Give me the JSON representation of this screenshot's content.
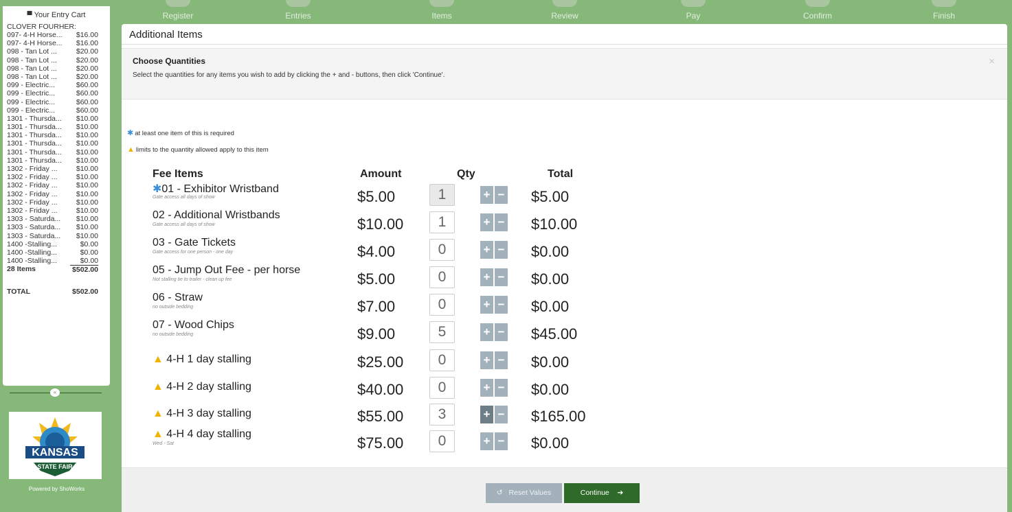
{
  "cart": {
    "title": "Your Entry Cart",
    "icon": "cart-icon",
    "owner": "CLOVER FOURHER:",
    "items": [
      {
        "name": "097- 4-H Horse...",
        "price": "$16.00"
      },
      {
        "name": "097- 4-H Horse...",
        "price": "$16.00"
      },
      {
        "name": "098 - Tan Lot ...",
        "price": "$20.00"
      },
      {
        "name": "098 - Tan Lot ...",
        "price": "$20.00"
      },
      {
        "name": "098 - Tan Lot ...",
        "price": "$20.00"
      },
      {
        "name": "098 - Tan Lot ...",
        "price": "$20.00"
      },
      {
        "name": "099 - Electric...",
        "price": "$60.00"
      },
      {
        "name": "099 - Electric...",
        "price": "$60.00"
      },
      {
        "name": "099 - Electric...",
        "price": "$60.00"
      },
      {
        "name": "099 - Electric...",
        "price": "$60.00"
      },
      {
        "name": "1301 - Thursda...",
        "price": "$10.00"
      },
      {
        "name": "1301 - Thursda...",
        "price": "$10.00"
      },
      {
        "name": "1301 - Thursda...",
        "price": "$10.00"
      },
      {
        "name": "1301 - Thursda...",
        "price": "$10.00"
      },
      {
        "name": "1301 - Thursda...",
        "price": "$10.00"
      },
      {
        "name": "1301 - Thursda...",
        "price": "$10.00"
      },
      {
        "name": "1302 - Friday ...",
        "price": "$10.00"
      },
      {
        "name": "1302 - Friday ...",
        "price": "$10.00"
      },
      {
        "name": "1302 - Friday ...",
        "price": "$10.00"
      },
      {
        "name": "1302 - Friday ...",
        "price": "$10.00"
      },
      {
        "name": "1302 - Friday ...",
        "price": "$10.00"
      },
      {
        "name": "1302 - Friday ...",
        "price": "$10.00"
      },
      {
        "name": "1303 - Saturda...",
        "price": "$10.00"
      },
      {
        "name": "1303 - Saturda...",
        "price": "$10.00"
      },
      {
        "name": "1303 - Saturda...",
        "price": "$10.00"
      },
      {
        "name": "1400 -Stalling...",
        "price": "$0.00"
      },
      {
        "name": "1400 -Stalling...",
        "price": "$0.00"
      },
      {
        "name": "1400 -Stalling...",
        "price": "$0.00"
      }
    ],
    "count_label": "28 Items",
    "subtotal": "$502.00",
    "total_label": "TOTAL",
    "total": "$502.00"
  },
  "collapse_icon": "double-chevron-left-icon",
  "logo": {
    "line1": "KANSAS",
    "line2": "STATE FAIR"
  },
  "powered_by": "Powered by ShoWorks",
  "steps": [
    "Register",
    "Entries",
    "Items",
    "Review",
    "Pay",
    "Confirm",
    "Finish"
  ],
  "panel": {
    "title": "Additional Items",
    "info_title": "Choose Quantities",
    "info_text": "Select the quantities for any items you wish to add by clicking the + and - buttons, then click 'Continue'.",
    "close_glyph": "×",
    "legend_required": "at least one item of this is required",
    "legend_limit": "limits to the quantity allowed apply to this item",
    "headers": {
      "item": "Fee Items",
      "amount": "Amount",
      "qty": "Qty",
      "total": "Total"
    }
  },
  "fee_items": [
    {
      "name": "01 - Exhibitor Wristband",
      "desc": "Gate access all days of show",
      "amount": "$5.00",
      "qty": "1",
      "total": "$5.00",
      "marker": "required"
    },
    {
      "name": "02 - Additional Wristbands",
      "desc": "Gate access all days of show",
      "amount": "$10.00",
      "qty": "1",
      "total": "$10.00",
      "marker": ""
    },
    {
      "name": "03 - Gate Tickets",
      "desc": "Gate access for one person - one day",
      "amount": "$4.00",
      "qty": "0",
      "total": "$0.00",
      "marker": ""
    },
    {
      "name": "05 - Jump Out Fee - per horse",
      "desc": "Not stalling tie to trailer - clean up fee",
      "amount": "$5.00",
      "qty": "0",
      "total": "$0.00",
      "marker": ""
    },
    {
      "name": "06 - Straw",
      "desc": "no outside bedding",
      "amount": "$7.00",
      "qty": "0",
      "total": "$0.00",
      "marker": ""
    },
    {
      "name": "07 - Wood Chips",
      "desc": "no outside bedding",
      "amount": "$9.00",
      "qty": "5",
      "total": "$45.00",
      "marker": ""
    },
    {
      "name": "4-H 1 day stalling",
      "desc": "",
      "amount": "$25.00",
      "qty": "0",
      "total": "$0.00",
      "marker": "limit"
    },
    {
      "name": "4-H 2 day stalling",
      "desc": "",
      "amount": "$40.00",
      "qty": "0",
      "total": "$0.00",
      "marker": "limit"
    },
    {
      "name": "4-H 3 day stalling",
      "desc": "",
      "amount": "$55.00",
      "qty": "3",
      "total": "$165.00",
      "marker": "limit"
    },
    {
      "name": "4-H 4 day stalling",
      "desc": "Wed - Sat",
      "amount": "$75.00",
      "qty": "0",
      "total": "$0.00",
      "marker": "limit"
    }
  ],
  "buttons": {
    "reset": "Reset Values",
    "continue": "Continue"
  }
}
